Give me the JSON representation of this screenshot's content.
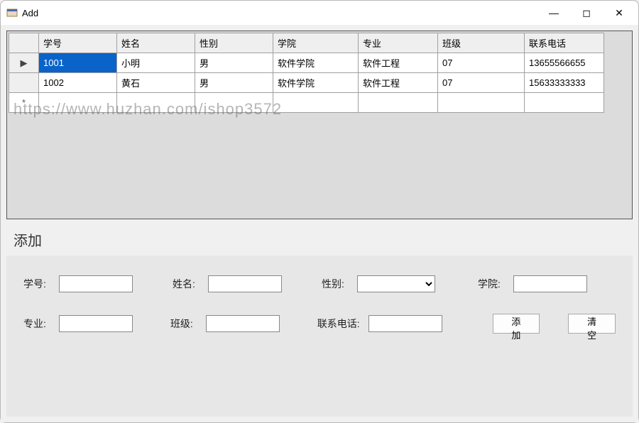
{
  "window": {
    "title": "Add"
  },
  "grid": {
    "headers": [
      "学号",
      "姓名",
      "性别",
      "学院",
      "专业",
      "班级",
      "联系电话"
    ],
    "rows": [
      {
        "selected": true,
        "cells": [
          "1001",
          "小明",
          "男",
          "软件学院",
          "软件工程",
          "07",
          "13655566655"
        ]
      },
      {
        "selected": false,
        "cells": [
          "1002",
          "黄石",
          "男",
          "软件学院",
          "软件工程",
          "07",
          "15633333333"
        ]
      }
    ],
    "row_indicator": "▶",
    "new_row_indicator": "*"
  },
  "section": {
    "heading": "添加"
  },
  "form": {
    "labels": {
      "student_id": "学号:",
      "name": "姓名:",
      "sex": "性别:",
      "college": "学院:",
      "major": "专业:",
      "class": "班级:",
      "phone": "联系电话:"
    },
    "values": {
      "student_id": "",
      "name": "",
      "sex": "",
      "college": "",
      "major": "",
      "class": "",
      "phone": ""
    },
    "buttons": {
      "add": "添加",
      "clear": "清空"
    }
  },
  "watermark": "https://www.huzhan.com/ishop3572"
}
